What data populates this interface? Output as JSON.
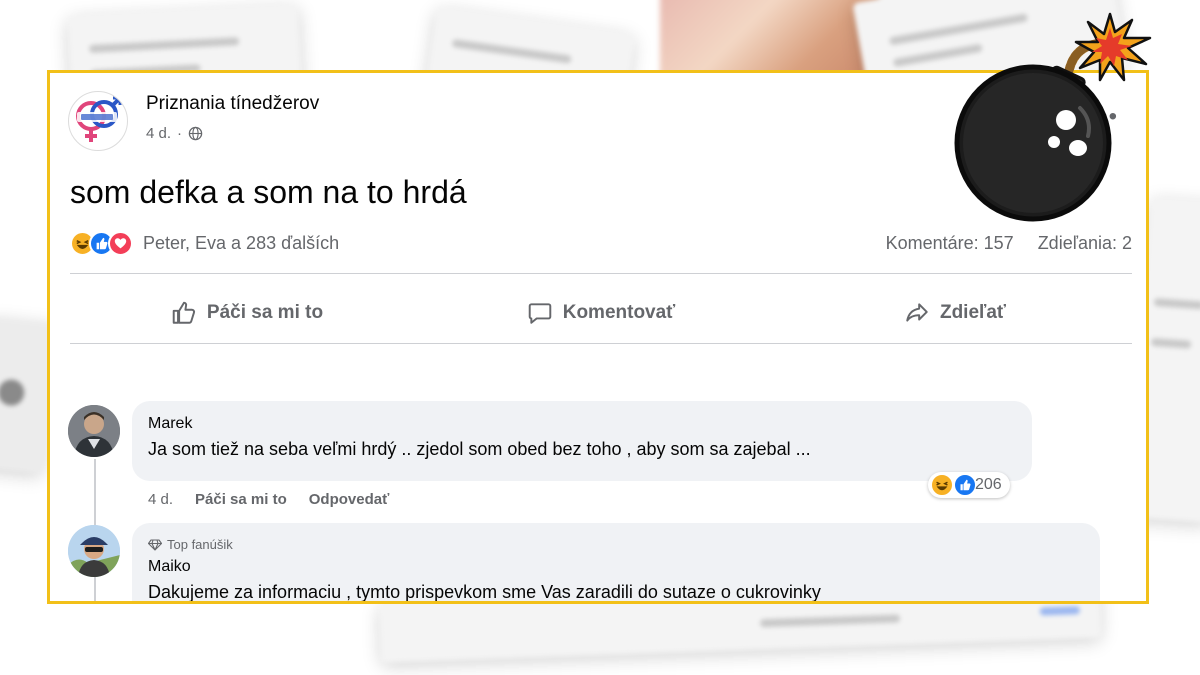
{
  "post": {
    "page_name": "Priznania tínedžerov",
    "time": "4 d.",
    "text": "som defka a som na to hrdá",
    "reactions_summary": "Peter, Eva a 283 ďalších",
    "comments_count": "Komentáre: 157",
    "shares_count": "Zdieľania: 2",
    "icons": [
      "haha-reaction-icon",
      "like-reaction-icon",
      "love-reaction-icon",
      "globe-icon",
      "more-options-icon"
    ]
  },
  "actions": {
    "like_label": "Páči sa mi to",
    "comment_label": "Komentovať",
    "share_label": "Zdieľať"
  },
  "comments": [
    {
      "name": "Marek",
      "text": "Ja som tiež na seba veľmi hrdý .. zjedol som obed bez toho , aby som sa zajebal ...",
      "time": "4 d.",
      "like_label": "Páči sa mi to",
      "reply_label": "Odpovedať",
      "reaction_count": "206"
    },
    {
      "badge": "Top fanúšik",
      "name": "Maiko",
      "text": "Dakujeme za informaciu , tymto prispevkom sme Vas zaradili do sutaze o cukrovinky"
    }
  ],
  "colors": {
    "frame": "#f2c018",
    "like_blue": "#1877f2",
    "love_red": "#f33e58",
    "haha_yellow": "#f7b125",
    "secondary_text": "#65676b"
  }
}
